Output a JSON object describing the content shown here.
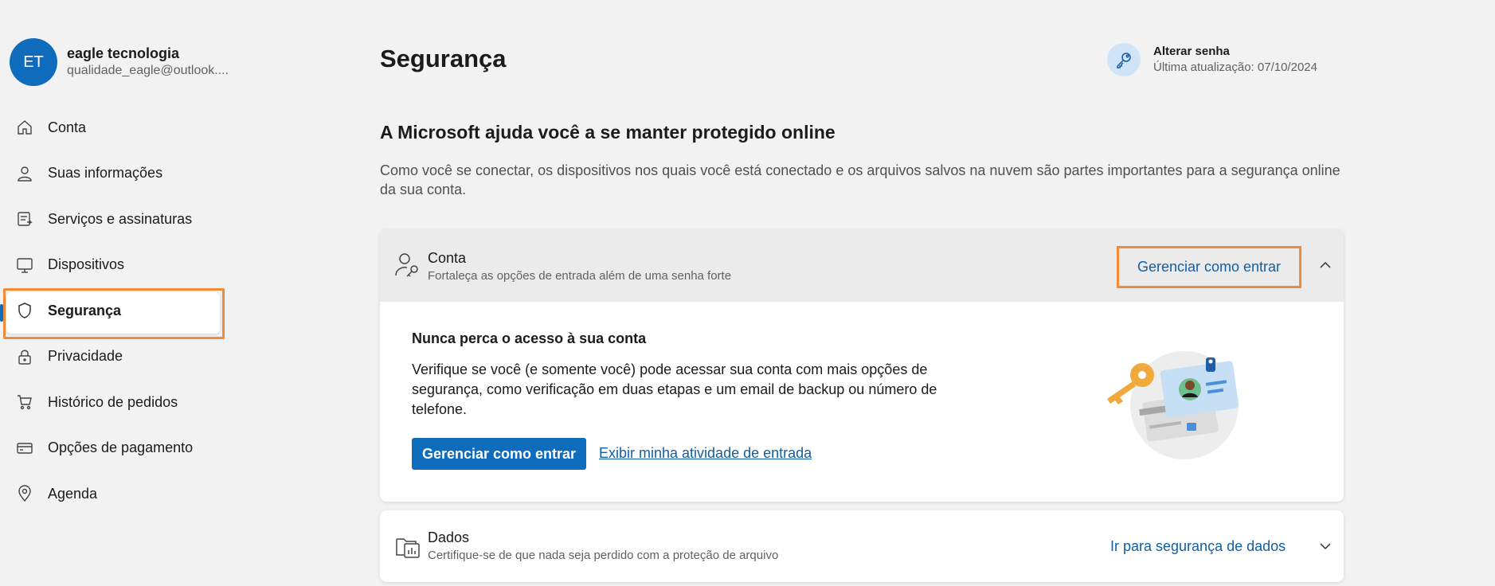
{
  "profile": {
    "initials": "ET",
    "name": "eagle tecnologia",
    "email": "qualidade_eagle@outlook...."
  },
  "nav": [
    {
      "label": "Conta",
      "icon": "home-icon"
    },
    {
      "label": "Suas informações",
      "icon": "person-icon"
    },
    {
      "label": "Serviços e assinaturas",
      "icon": "subscriptions-icon"
    },
    {
      "label": "Dispositivos",
      "icon": "monitor-icon"
    },
    {
      "label": "Segurança",
      "icon": "shield-icon",
      "active": true
    },
    {
      "label": "Privacidade",
      "icon": "lock-icon"
    },
    {
      "label": "Histórico de pedidos",
      "icon": "cart-icon"
    },
    {
      "label": "Opções de pagamento",
      "icon": "credit-card-icon"
    },
    {
      "label": "Agenda",
      "icon": "location-icon"
    }
  ],
  "header": {
    "title": "Segurança",
    "password": {
      "title": "Alterar senha",
      "subtitle": "Última atualização: 07/10/2024"
    }
  },
  "main": {
    "subtitle": "A Microsoft ajuda você a se manter protegido online",
    "description": "Como você se conectar, os dispositivos nos quais você está conectado e os arquivos salvos na nuvem são partes importantes para a segurança online da sua conta."
  },
  "card_conta": {
    "title": "Conta",
    "subtitle": "Fortaleça as opções de entrada além de uma senha forte",
    "action": "Gerenciar como entrar",
    "body_title": "Nunca perca o acesso à sua conta",
    "body_text": "Verifique se você (e somente você) pode acessar sua conta com mais opções de segurança, como verificação em duas etapas e um email de backup ou número de telefone.",
    "primary_button": "Gerenciar como entrar",
    "link": "Exibir minha atividade de entrada"
  },
  "card_dados": {
    "title": "Dados",
    "subtitle": "Certifique-se de que nada seja perdido com a proteção de arquivo",
    "action": "Ir para segurança de dados"
  },
  "colors": {
    "accent": "#0f6cbd",
    "link": "#115ea3",
    "highlight": "#f08b3a"
  }
}
